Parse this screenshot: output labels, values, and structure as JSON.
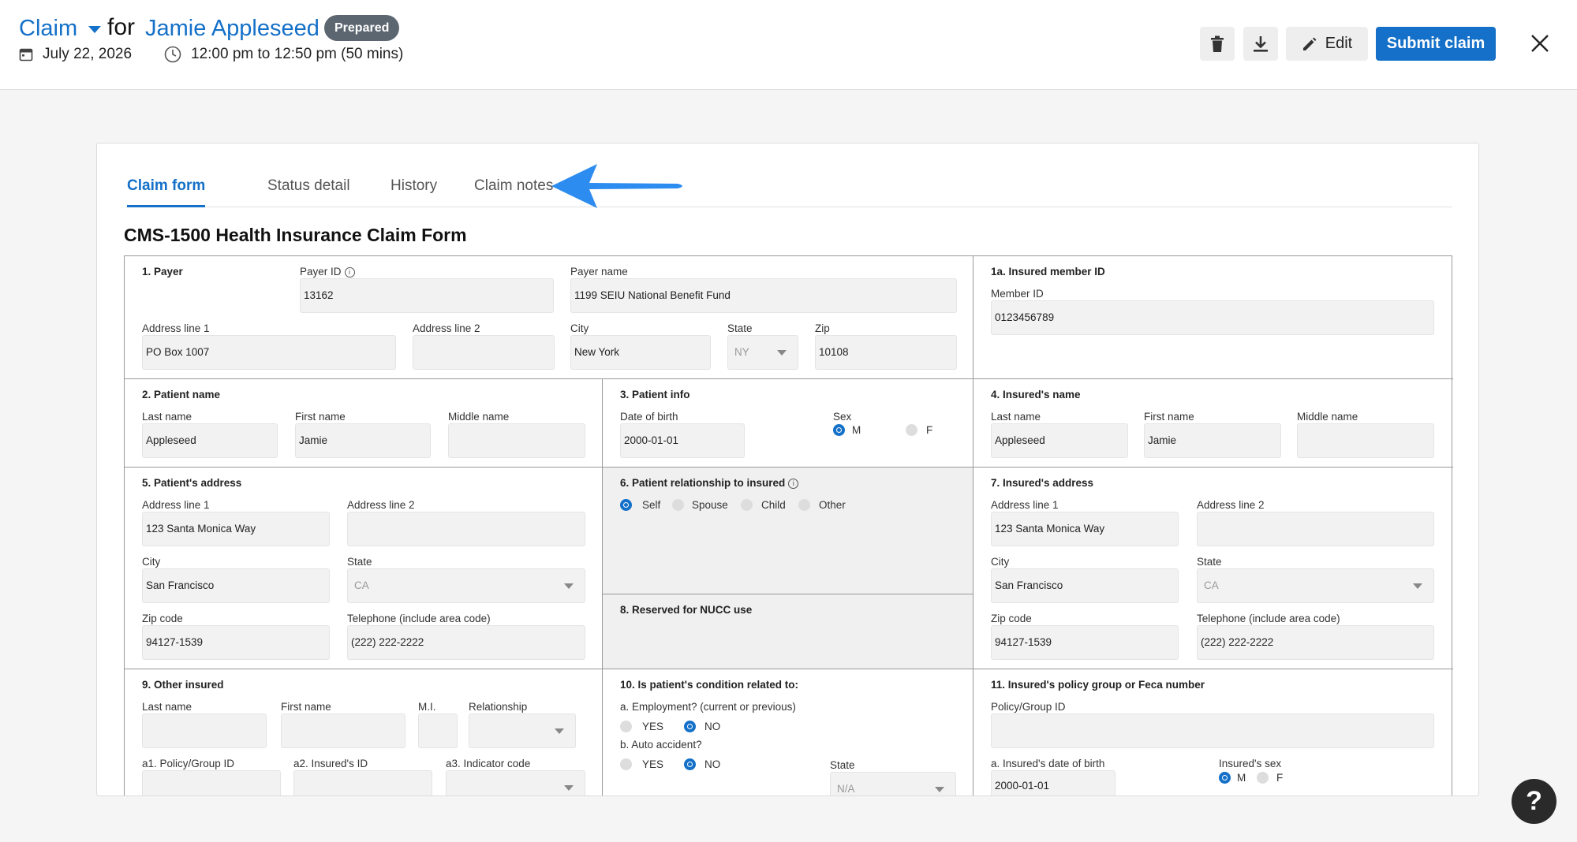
{
  "header": {
    "claim_label": "Claim",
    "for_label": "for",
    "patient_name": "Jamie Appleseed",
    "status_badge": "Prepared",
    "date": "July 22, 2026",
    "time": "12:00 pm to 12:50 pm (50 mins)",
    "edit_label": "Edit",
    "submit_label": "Submit claim"
  },
  "tabs": [
    "Claim form",
    "Status detail",
    "History",
    "Claim notes"
  ],
  "form_title": "CMS-1500 Health Insurance Claim Form",
  "payer": {
    "title": "1. Payer",
    "payer_id_label": "Payer ID",
    "payer_id": "13162",
    "payer_name_label": "Payer name",
    "payer_name": "1199 SEIU National Benefit Fund",
    "addr1_label": "Address line 1",
    "addr1": "PO Box 1007",
    "addr2_label": "Address line 2",
    "addr2": "",
    "city_label": "City",
    "city": "New York",
    "state_label": "State",
    "state": "NY",
    "zip_label": "Zip",
    "zip": "10108"
  },
  "insured_member": {
    "title": "1a. Insured member ID",
    "member_id_label": "Member ID",
    "member_id": "0123456789"
  },
  "patient_name": {
    "title": "2. Patient name",
    "last_label": "Last name",
    "last": "Appleseed",
    "first_label": "First name",
    "first": "Jamie",
    "middle_label": "Middle name",
    "middle": ""
  },
  "patient_info": {
    "title": "3. Patient info",
    "dob_label": "Date of birth",
    "dob": "2000-01-01",
    "sex_label": "Sex",
    "sex_m": "M",
    "sex_f": "F"
  },
  "insured_name": {
    "title": "4. Insured's name",
    "last_label": "Last name",
    "last": "Appleseed",
    "first_label": "First name",
    "first": "Jamie",
    "middle_label": "Middle name",
    "middle": ""
  },
  "patient_address": {
    "title": "5. Patient's address",
    "addr1_label": "Address line 1",
    "addr1": "123 Santa Monica Way",
    "addr2_label": "Address line 2",
    "addr2": "",
    "city_label": "City",
    "city": "San Francisco",
    "state_label": "State",
    "state": "CA",
    "zip_label": "Zip code",
    "zip": "94127-1539",
    "phone_label": "Telephone (include area code)",
    "phone": "(222) 222-2222"
  },
  "relationship": {
    "title": "6. Patient relationship to insured",
    "options": [
      "Self",
      "Spouse",
      "Child",
      "Other"
    ]
  },
  "nucc": {
    "title": "8. Reserved for NUCC use"
  },
  "insured_address": {
    "title": "7. Insured's address",
    "addr1_label": "Address line 1",
    "addr1": "123 Santa Monica Way",
    "addr2_label": "Address line 2",
    "addr2": "",
    "city_label": "City",
    "city": "San Francisco",
    "state_label": "State",
    "state": "CA",
    "zip_label": "Zip code",
    "zip": "94127-1539",
    "phone_label": "Telephone (include area code)",
    "phone": "(222) 222-2222"
  },
  "other_insured": {
    "title": "9. Other insured",
    "last_label": "Last name",
    "first_label": "First name",
    "mi_label": "M.I.",
    "relationship_label": "Relationship",
    "a1_label": "a1. Policy/Group ID",
    "a2_label": "a2. Insured's ID",
    "a3_label": "a3. Indicator code"
  },
  "condition": {
    "title": "10. Is patient's condition related to:",
    "employment_label": "a. Employment? (current or previous)",
    "auto_label": "b. Auto accident?",
    "yes": "YES",
    "no": "NO",
    "state_label": "State",
    "state": "N/A"
  },
  "policy_group": {
    "title": "11. Insured's policy group or Feca number",
    "policy_label": "Policy/Group ID",
    "policy": "",
    "dob_label": "a. Insured's date of birth",
    "dob": "2000-01-01",
    "sex_label": "Insured's sex",
    "sex_m": "M",
    "sex_f": "F"
  },
  "help_label": "?",
  "colors": {
    "accent": "#1470c8",
    "badge": "#5c6670",
    "arrow": "#2d8cf0"
  }
}
